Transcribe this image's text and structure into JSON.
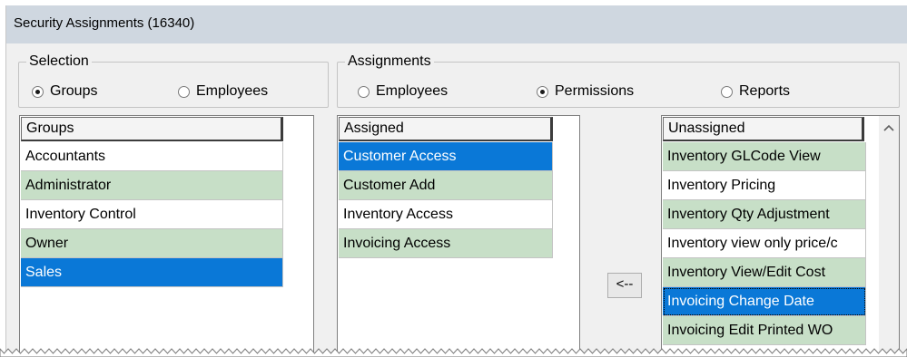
{
  "window": {
    "title": "Security Assignments (16340)"
  },
  "selection": {
    "legend": "Selection",
    "options": [
      {
        "label": "Groups",
        "checked": true
      },
      {
        "label": "Employees",
        "checked": false
      }
    ]
  },
  "assignments": {
    "legend": "Assignments",
    "options": [
      {
        "label": "Employees",
        "checked": false
      },
      {
        "label": "Permissions",
        "checked": true
      },
      {
        "label": "Reports",
        "checked": false
      }
    ]
  },
  "groups_list": {
    "header": "Groups",
    "rows": [
      {
        "label": "Accountants",
        "style": "white"
      },
      {
        "label": "Administrator",
        "style": "green"
      },
      {
        "label": "Inventory Control",
        "style": "white"
      },
      {
        "label": "Owner",
        "style": "green"
      },
      {
        "label": "Sales",
        "style": "selected"
      }
    ]
  },
  "assigned_list": {
    "header": "Assigned",
    "rows": [
      {
        "label": "Customer Access",
        "style": "selected"
      },
      {
        "label": "Customer Add",
        "style": "green"
      },
      {
        "label": "Inventory Access",
        "style": "white"
      },
      {
        "label": "Invoicing Access",
        "style": "green"
      }
    ]
  },
  "unassigned_list": {
    "header": "Unassigned",
    "rows": [
      {
        "label": "Inventory GLCode View",
        "style": "green"
      },
      {
        "label": "Inventory Pricing",
        "style": "white"
      },
      {
        "label": "Inventory Qty Adjustment",
        "style": "green"
      },
      {
        "label": "Inventory view only price/c",
        "style": "white"
      },
      {
        "label": "Inventory View/Edit Cost",
        "style": "green"
      },
      {
        "label": "Invoicing Change Date",
        "style": "focused"
      },
      {
        "label": "Invoicing Edit Printed WO",
        "style": "green"
      }
    ]
  },
  "move_button": {
    "label": "<--"
  },
  "icons": {
    "scroll_up": "chevron-up-icon"
  },
  "colors": {
    "selected": "#0a78d7",
    "alt_row": "#c7dfc7",
    "titlebar": "#cfd7e0"
  }
}
